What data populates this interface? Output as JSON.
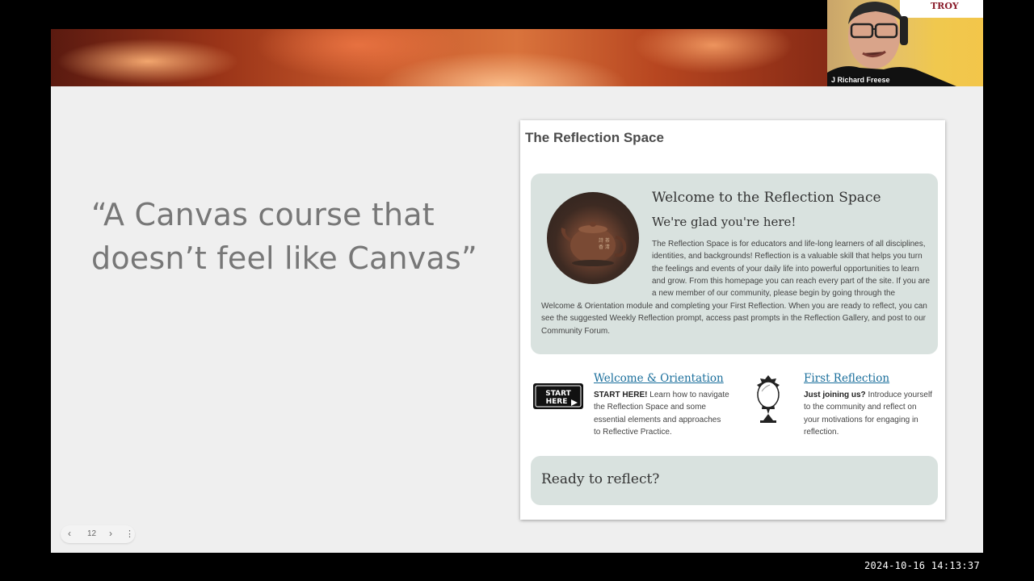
{
  "slide": {
    "quote": "“A Canvas course that doesn’t feel like Canvas”",
    "page_number": "12",
    "prev_icon": "‹",
    "next_icon": "›",
    "more_icon": "⋮"
  },
  "panel": {
    "title": "The Reflection Space",
    "welcome_heading": "Welcome to the Reflection Space",
    "welcome_subheading": "We're glad you're here!",
    "welcome_paragraph_a": "The Reflection Space is for educators and life-long learners of all disciplines, identities, and backgrounds!  Reflection is a valuable skill that helps you turn the feelings and events of your daily life into powerful opportunities to learn and grow.  From this homepage you can reach every part of the site. If you are a new member of our community, please begin by going through the",
    "welcome_paragraph_b": "Welcome & Orientation module and completing your First Reflection. When you are ready to reflect, you can see the suggested Weekly Reflection prompt, access past prompts in the Reflection Gallery, and post to our Community Forum.",
    "card1": {
      "icon_name": "start-here-sign-icon",
      "icon_text_1": "START",
      "icon_text_2": "HERE",
      "link": "Welcome & Orientation",
      "lead": "START HERE!",
      "desc_1": " Learn how to navigate",
      "desc_2": "the Reflection Space and some",
      "desc_3": "essential elements and approaches",
      "desc_4": "to Reflective Practice."
    },
    "card2": {
      "icon_name": "ornate-mirror-icon",
      "link": "First Reflection",
      "lead": "Just joining us?",
      "desc_1": " Introduce yourself",
      "desc_2": "to the community and reflect on",
      "desc_3": "your motivations for engaging in",
      "desc_4": "reflection."
    },
    "ready": "Ready to reflect?"
  },
  "video": {
    "participant": "J Richard Freese",
    "sign_text": "TROY"
  },
  "timestamp": "2024-10-16  14:13:37",
  "colors": {
    "link": "#1b6f9c",
    "box": "#d9e2df",
    "slide_bg": "#efefef"
  }
}
